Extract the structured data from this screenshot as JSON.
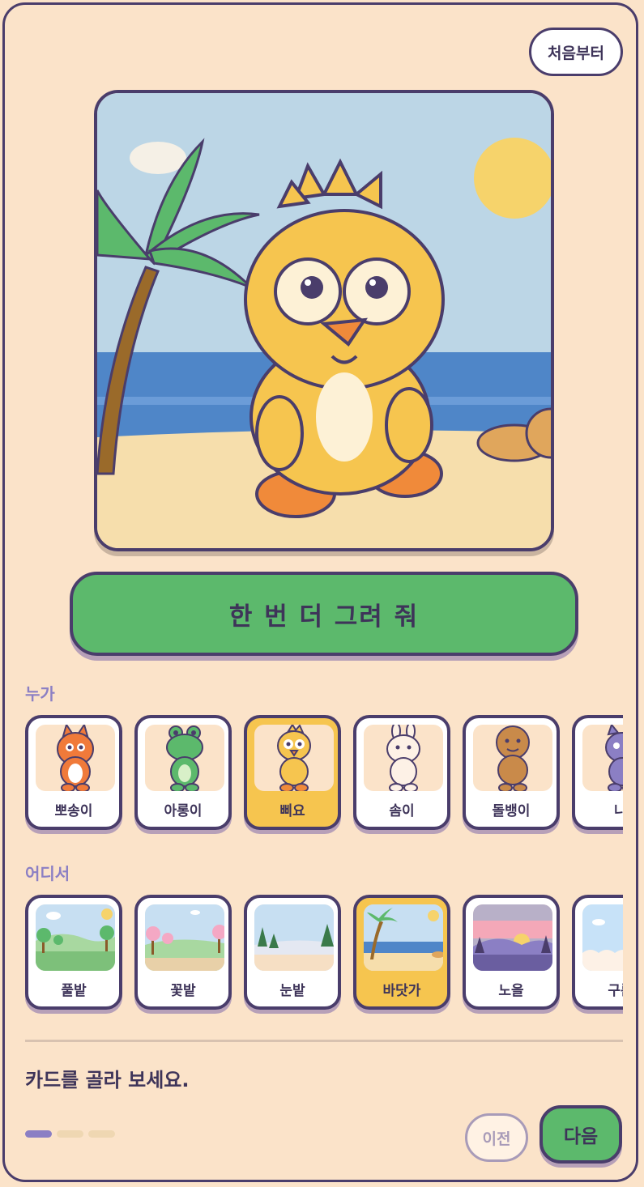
{
  "header": {
    "restart_label": "처음부터"
  },
  "scene": {
    "background": "beach",
    "character": "chick"
  },
  "actions": {
    "redraw_label": "한 번 더 그려 줘"
  },
  "who": {
    "label": "누가",
    "items": [
      {
        "label": "뽀송이",
        "icon": "fox-icon",
        "selected": false
      },
      {
        "label": "아롱이",
        "icon": "frog-icon",
        "selected": false
      },
      {
        "label": "삐요",
        "icon": "chick-icon",
        "selected": true
      },
      {
        "label": "솜이",
        "icon": "bunny-icon",
        "selected": false
      },
      {
        "label": "돌뱅이",
        "icon": "gingerbread-icon",
        "selected": false
      },
      {
        "label": "나",
        "icon": "cat-icon",
        "selected": false
      }
    ]
  },
  "where": {
    "label": "어디서",
    "items": [
      {
        "label": "풀밭",
        "icon": "meadow-icon",
        "selected": false
      },
      {
        "label": "꽃밭",
        "icon": "flower-field-icon",
        "selected": false
      },
      {
        "label": "눈밭",
        "icon": "snow-field-icon",
        "selected": false
      },
      {
        "label": "바닷가",
        "icon": "beach-icon",
        "selected": true
      },
      {
        "label": "노을",
        "icon": "sunset-icon",
        "selected": false
      },
      {
        "label": "구름",
        "icon": "cloud-icon",
        "selected": false
      }
    ]
  },
  "footer": {
    "prompt": "카드를 골라 보세요.",
    "progress_step": 1,
    "progress_total": 3,
    "prev_label": "이전",
    "next_label": "다음"
  },
  "colors": {
    "accent_green": "#5cb96c",
    "selected_yellow": "#f6c54f",
    "outline": "#4a3d6b",
    "background": "#fbe3c9",
    "label_purple": "#8b7fc4"
  }
}
